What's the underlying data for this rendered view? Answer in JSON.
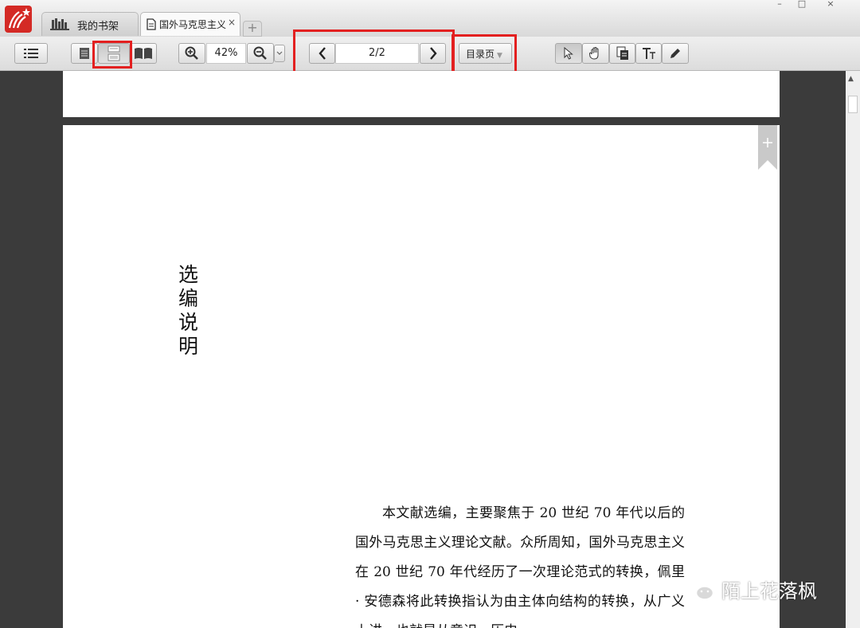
{
  "window": {
    "controls": [
      "–",
      "□",
      "×"
    ]
  },
  "tabs": [
    {
      "label": "我的书架",
      "icon": "bookshelf-icon"
    },
    {
      "label": "国外马克思主义",
      "icon": "document-icon",
      "close": "×"
    }
  ],
  "tab_add": "+",
  "toolbar": {
    "zoom": "42%",
    "page": "2/2",
    "toc_label": "目录页",
    "toc_caret": "▼",
    "icons": [
      "list-icon",
      "single-page-icon",
      "continuous-page-icon",
      "two-page-icon",
      "zoom-in-icon",
      "zoom-out-icon",
      "chevron-down-icon",
      "prev-page-icon",
      "next-page-icon",
      "select-cursor-icon",
      "hand-pan-icon",
      "copy-page-icon",
      "text-tool-icon",
      "pen-icon"
    ]
  },
  "highlight_color": "#e32020",
  "document": {
    "vertical_title": "选编说明",
    "paragraph": "本文献选编，主要聚焦于 20 世纪 70 年代以后的国外马克思主义理论文献。众所周知，国外马克思主义在 20 世纪 70 年代经历了一次理论范式的转换，佩里 · 安德森将此转换指认为由主体向结构的转换，从广义上讲，也就是从意识、历史"
  },
  "watermark": {
    "text": "陌上花落枫",
    "icon": "wechat-icon"
  }
}
